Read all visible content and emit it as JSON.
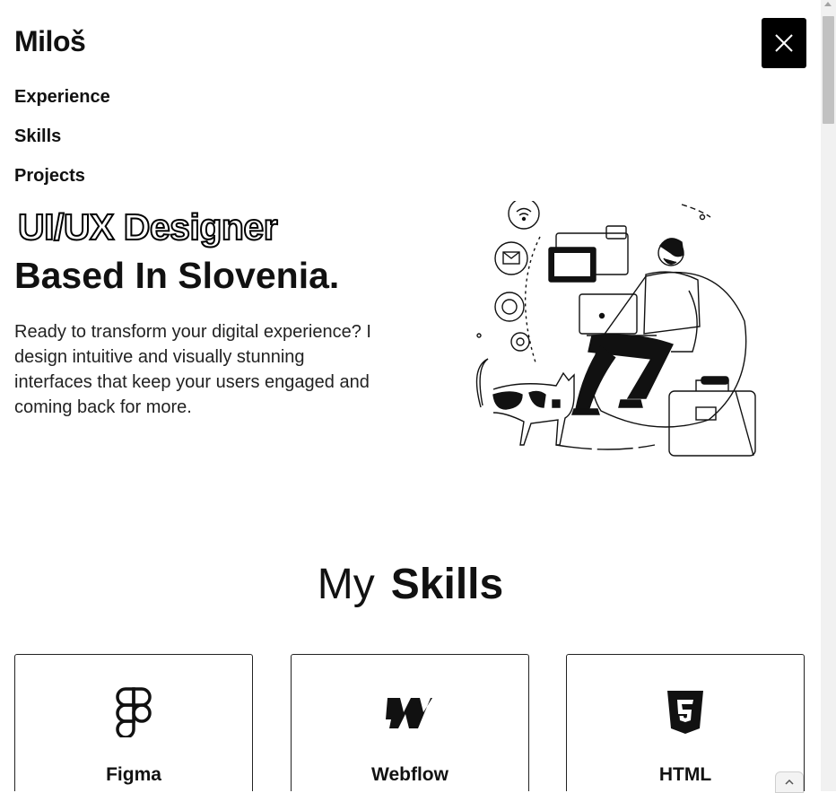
{
  "brand": {
    "name": "Miloš"
  },
  "nav": {
    "items": [
      "Experience",
      "Skills",
      "Projects"
    ]
  },
  "hero": {
    "title_outline": "UI/UX Designer",
    "title_solid": "Based In Slovenia.",
    "description": "Ready to transform your digital experience? I design intuitive and visually stunning interfaces that keep your users engaged and coming back for more."
  },
  "skills": {
    "heading_light": "My",
    "heading_bold": "Skills",
    "cards": [
      {
        "name": "Figma",
        "icon": "figma-icon"
      },
      {
        "name": "Webflow",
        "icon": "webflow-icon"
      },
      {
        "name": "HTML",
        "icon": "html5-icon"
      }
    ]
  },
  "icons": {
    "close": "close-icon",
    "back_to_top": "chevron-up-icon"
  },
  "colors": {
    "text": "#111111",
    "accent": "#000000",
    "background": "#ffffff"
  }
}
